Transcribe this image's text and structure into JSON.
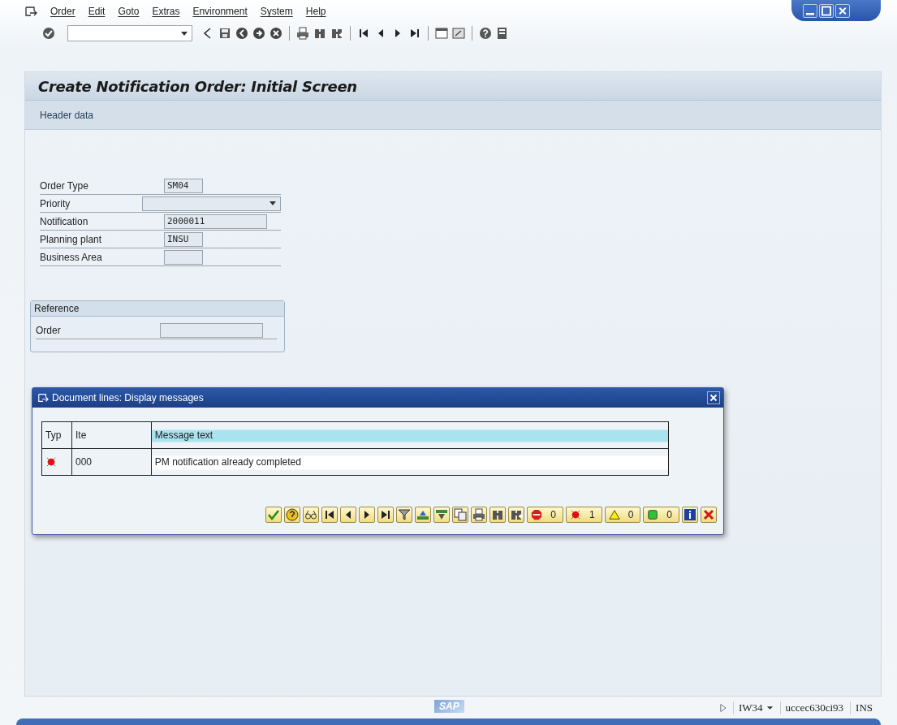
{
  "menu": [
    {
      "label": "Order"
    },
    {
      "label": "Edit"
    },
    {
      "label": "Goto"
    },
    {
      "label": "Extras"
    },
    {
      "label": "Environment"
    },
    {
      "label": "System"
    },
    {
      "label": "Help"
    }
  ],
  "screen": {
    "title": "Create Notification Order: Initial Screen",
    "section": "Header data"
  },
  "fields": [
    {
      "label": "Order Type",
      "value": "SM04",
      "kind": "short"
    },
    {
      "label": "Priority",
      "kind": "dropdown"
    },
    {
      "label": "Notification",
      "value": "2000011",
      "kind": "medium"
    },
    {
      "label": "Planning plant",
      "value": "INSU",
      "kind": "short"
    },
    {
      "label": "Business Area",
      "kind": "short"
    }
  ],
  "reference": {
    "title": "Reference",
    "fields": [
      {
        "label": "Order",
        "kind": "medium"
      }
    ]
  },
  "dialog": {
    "title": "Document lines: Display messages",
    "columns": [
      "Typ",
      "Ite",
      "Message text"
    ],
    "rows": [
      {
        "kind": "error",
        "item": "000",
        "text": "PM notification already completed"
      }
    ],
    "counters": [
      {
        "kind": "stop",
        "count": "0"
      },
      {
        "kind": "error",
        "count": "1"
      },
      {
        "kind": "warning",
        "count": "0"
      },
      {
        "kind": "success",
        "count": "0"
      }
    ]
  },
  "status_bar": {
    "logo": "SAP",
    "transaction": "IW34",
    "server": "uccec630ci93",
    "mode": "INS"
  }
}
